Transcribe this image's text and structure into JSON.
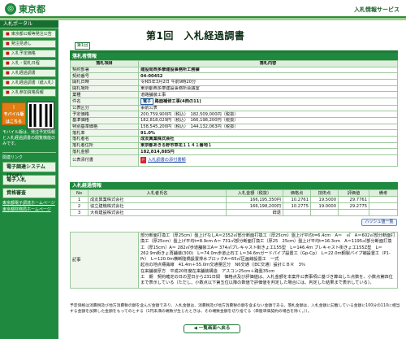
{
  "header": {
    "logo_mark": "◎",
    "logo_text": "東京都",
    "service_name": "入札情報サービス"
  },
  "sidebar": {
    "title": "入札ポータル",
    "menu": [
      {
        "mark": "■",
        "label": "東京都公報等発注公告"
      },
      {
        "mark": "■",
        "label": "発注見通し"
      },
      {
        "mark": "■",
        "label": "入札予定価格"
      },
      {
        "mark": "■",
        "label": "入札・開札日程"
      },
      {
        "mark": "■",
        "label": "入札経過調書"
      },
      {
        "mark": "■",
        "label": "入札経過調書（紙入札）"
      },
      {
        "mark": "■",
        "label": "入札参加資格情報"
      }
    ],
    "mobile_label": "モバイル版",
    "mobile_sub": "はこちら",
    "mobile_note": "モバイル版は、発注予定情報と入札経過調書の閲覧機能のみです。",
    "links_title": "関連リンク",
    "sub_menu": [
      {
        "label": "電子調達システム(TOP)"
      },
      {
        "label": "電子入札"
      },
      {
        "label": "資格審査"
      }
    ],
    "links": [
      "東京都電子調達ホームページ",
      "東京都財務局ホームページ"
    ]
  },
  "page": {
    "title": "第1回　入札経過調書",
    "badge": "第1回"
  },
  "outline": {
    "section_title": "落札者情報",
    "col_item": "落札項目",
    "col_content": "落札内容",
    "rows": [
      {
        "key": "契約部署",
        "value": "建設局西多摩建設事務所工務課"
      },
      {
        "key": "契約番号",
        "value": "04-00452"
      },
      {
        "key": "開札日時",
        "value": "令和5年3月2日 午前9時20分"
      },
      {
        "key": "開札場所",
        "value": "東京都西多摩建設事務所会議室"
      },
      {
        "key": "業種",
        "value": "道路舗装工事"
      },
      {
        "key": "件名",
        "value": "路面補修工事(4西の11)"
      },
      {
        "key": "公表区分",
        "value": "事前公表"
      },
      {
        "key": "予定価格",
        "value": "200,759,900円（税込）　182,509,000円（税抜）"
      },
      {
        "key": "基準価格",
        "value": "182,818,029円（税込）　166,198,200円（税抜）"
      },
      {
        "key": "特別基準価格",
        "value": "158,545,200円（税込）　144,132,063円（税抜）"
      },
      {
        "key": "落札率",
        "value": "91.0%"
      },
      {
        "key": "落札者名",
        "value": "成友興業株式会社"
      },
      {
        "key": "落札者住所",
        "value": "東京都あきる野市草花１１４１番地１"
      },
      {
        "key": "落札金額",
        "value": "182,814,885円"
      },
      {
        "key": "公表添付書",
        "value": "入札調書の添付書類"
      }
    ],
    "kenmei_button": "電子",
    "attach_icon": "pdf-icon"
  },
  "bidders": {
    "section_title": "入札経過情報",
    "headers": [
      "No",
      "入札者氏名",
      "入札金額（税抜）",
      "価格点",
      "技術点",
      "評価値",
      "備考"
    ],
    "rows": [
      {
        "no": "1",
        "name": "成友興業株式会社",
        "amount": "166,195,350円",
        "price_pt": "10.2761",
        "tech_pt": "19.5000",
        "score": "29.7761",
        "note": ""
      },
      {
        "no": "2",
        "name": "協立建機株式会社",
        "amount": "166,198,200円",
        "price_pt": "10.2775",
        "tech_pt": "19.0000",
        "score": "29.2775",
        "note": ""
      },
      {
        "no": "3",
        "name": "大有建設株式会社",
        "amount": "辞退",
        "price_pt": "",
        "tech_pt": "",
        "score": "",
        "note": ""
      }
    ],
    "hashi_button": "ハッシュ値一覧"
  },
  "remarks": {
    "label": "記事",
    "text": "部分断面打換工（厚25cm）盤上げなしA＝2352㎡部分断面打換工（厚25cm）盤上げ平均t=6.4cm　A＝　㎡　A＝602㎡部分断面打換工（厚25cm）盤上げ平均t=8.9cm A＝ 731㎡部分断面打換工（厚25　25cm）盤上げ平均t=16.3cm　A＝1195㎡部分断面打換工（厚15cm）A＝ 282㎡歩道舗装工A＝ 374㎡プレキャスト街きょ工155型　L＝146.4m プレキャスト街きょ工155Z型　L＝262.9m街きょ再舗装(300)　L＝74.0m歩道止石工 L＝34.6mガードパイプ設置工（Gp-Cp）　L＝22.0m鋼製パイプ補設置工（P1-Pr）　L＝120.0m横断陸橋設置排水ブロックA＝65㎡区画線設置工　一式\n起点の地点標識線　41.4m＋55.0ｍ交通量区分　N6交通（旧C交通）設計ＣＢＲ　3％\n在来舗装厚方　平成20年度在来舗装構造　アスコン25cm＋路盤35cm\n工　期　契約確定の日の翌日から231日間　価格点及び評価値は、入札金額を本案件公表事項に基づき算出した点数を、小数点第四位まで表示している（ただし、小数点以下第五位以降の数値で評価値を判定した場合には、判定した結果まで表示している）。"
  },
  "footer": {
    "note": "予定価格は消費税及び地方消費税の額を含んだ金額であり、入札金額は、消費税及び地方消費税の額を含まない金額である。落札金額は、入札金額に記載している金額に100分の110に相当する金額を加算した金額をもってのとする（1円未満の端数が生じたときは、その端数金額を切り捨てる（単股単価契約の場合を除く。））。",
    "back_button": "一覧画面へ戻る"
  },
  "colors": {
    "brand_green": "#1f8a3f",
    "header_line": "#9fd08f"
  }
}
